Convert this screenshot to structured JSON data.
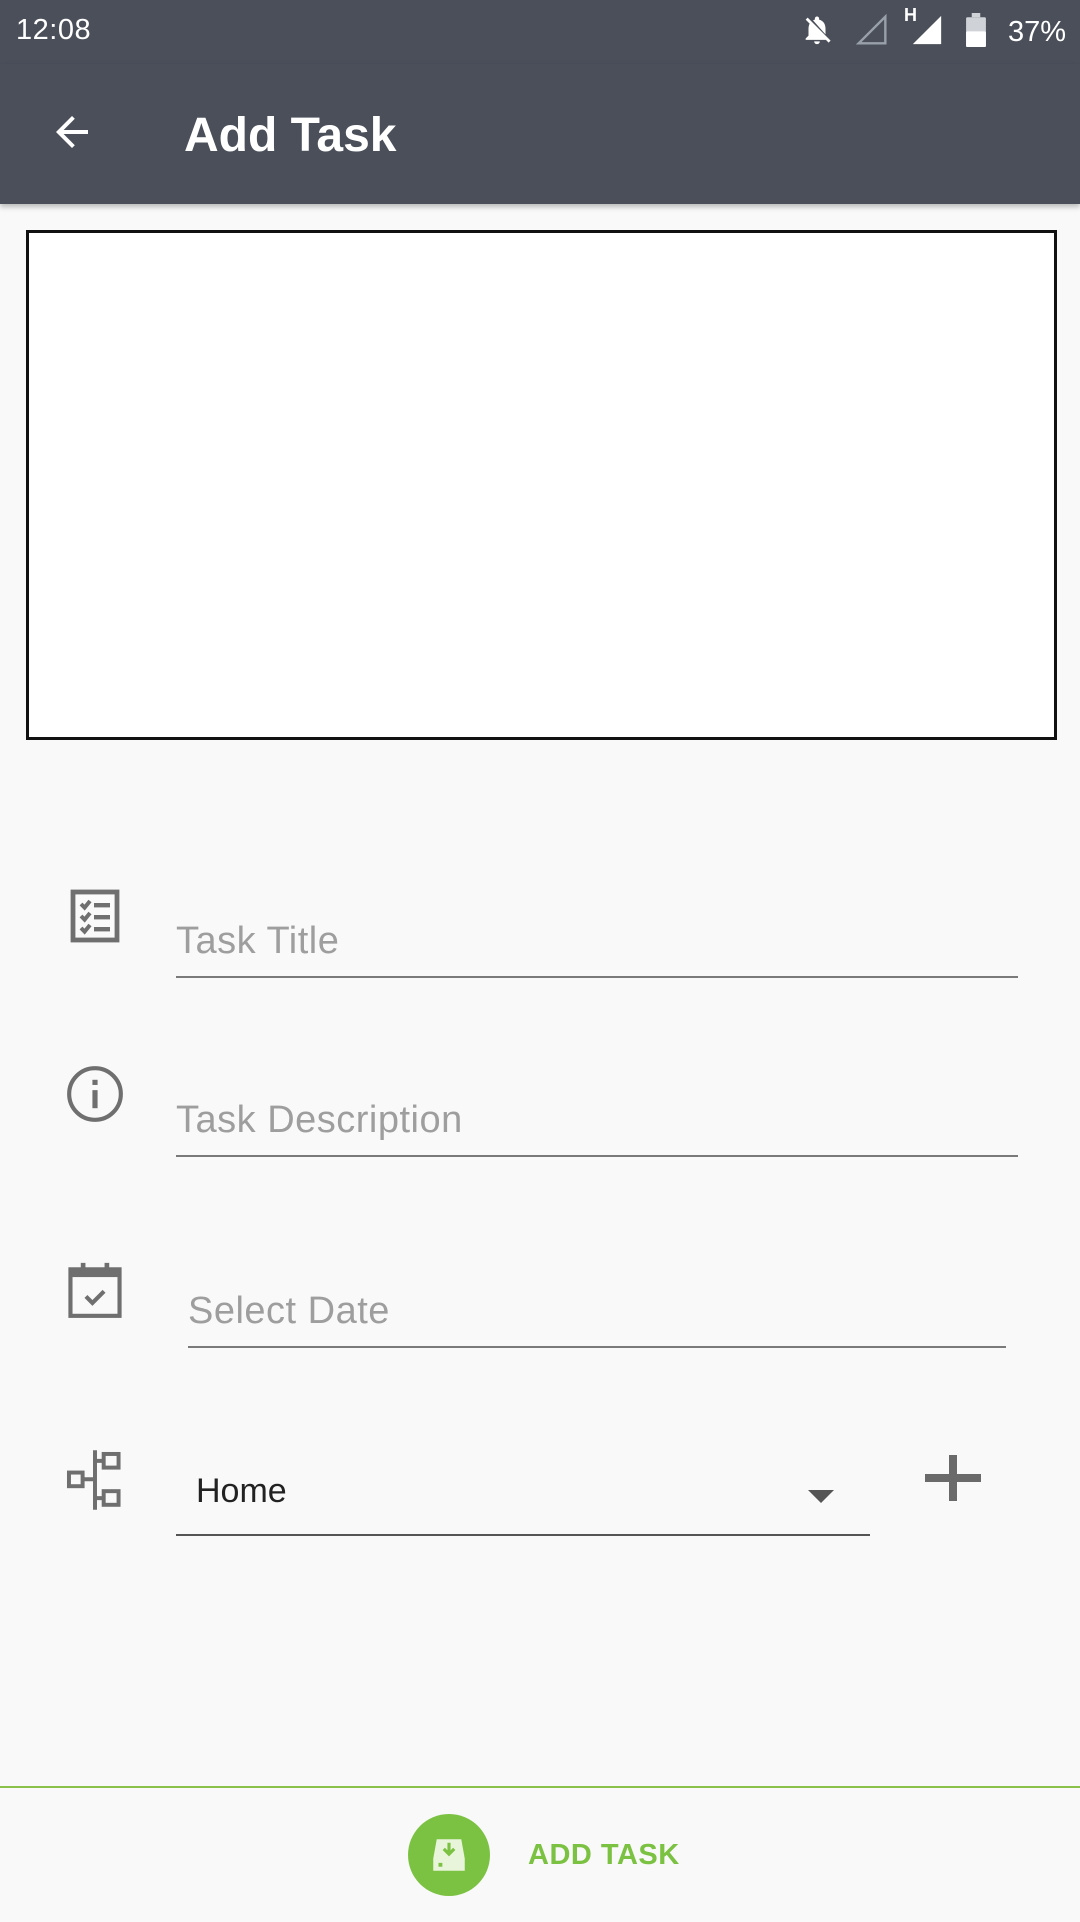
{
  "status_bar": {
    "time": "12:08",
    "network_type": "H",
    "battery_percent": "37%",
    "icons": [
      "notifications-off-icon",
      "signal-empty-icon",
      "signal-full-icon",
      "battery-icon"
    ]
  },
  "app_bar": {
    "title": "Add Task",
    "back_icon": "arrow-back-icon",
    "background_color": "#4a4f5a"
  },
  "form": {
    "title": {
      "placeholder": "Task Title",
      "value": "",
      "icon": "checklist-icon"
    },
    "description": {
      "placeholder": "Task Description",
      "value": "",
      "icon": "info-icon"
    },
    "date": {
      "placeholder": "Select Date",
      "value": "",
      "icon": "calendar-check-icon"
    },
    "category": {
      "selected": "Home",
      "icon": "hierarchy-icon",
      "add_icon": "plus-icon"
    }
  },
  "footer": {
    "button_label": "ADD TASK",
    "button_icon": "save-download-icon",
    "accent_color": "#7cc242"
  }
}
